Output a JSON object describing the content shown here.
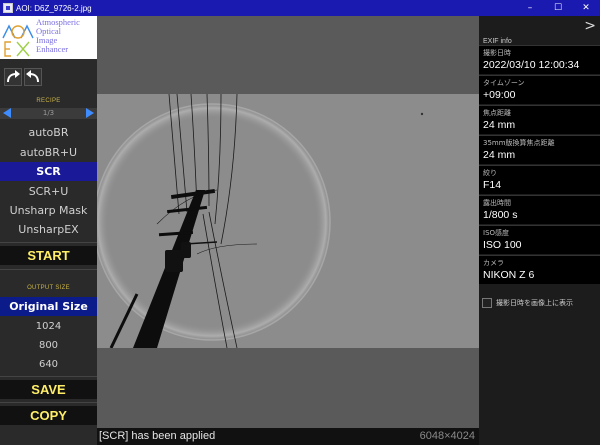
{
  "window": {
    "title": "AOI: D6Z_9726-2.jpg",
    "controls": {
      "minimize": "–",
      "maximize": "☐",
      "close": "✕"
    }
  },
  "logo": {
    "line1": "Atmospheric",
    "line2": "Optical",
    "line3": "Image",
    "line4": "Enhancer"
  },
  "recipe": {
    "label": "RECIPE",
    "pager": "1/3",
    "items": [
      "autoBR",
      "autoBR+U",
      "SCR",
      "SCR+U",
      "Unsharp Mask",
      "UnsharpEX"
    ],
    "active_index": 2
  },
  "start_label": "START",
  "output_size": {
    "label": "OUTPUT SIZE",
    "items": [
      "Original Size",
      "1024",
      "800",
      "640"
    ],
    "active_index": 0
  },
  "save_label": "SAVE",
  "copy_label": "COPY",
  "status": {
    "message": "[SCR] has been applied",
    "dimensions": "6048×4024"
  },
  "exif": {
    "title": "EXIF info",
    "collapse_glyph": ">",
    "rows": [
      {
        "label": "撮影日時",
        "value": "2022/03/10 12:00:34"
      },
      {
        "label": "タイムゾーン",
        "value": "+09:00"
      },
      {
        "label": "焦点距離",
        "value": "24 mm"
      },
      {
        "label": "35mm版換算焦点距離",
        "value": "24 mm"
      },
      {
        "label": "絞り",
        "value": "F14"
      },
      {
        "label": "露出時間",
        "value": "1/800 s"
      },
      {
        "label": "ISO感度",
        "value": "ISO 100"
      },
      {
        "label": "カメラ",
        "value": "NIKON Z 6"
      }
    ],
    "overlay_option": "撮影日時を画像上に表示"
  },
  "colors": {
    "titlebar": "#1a1ab0",
    "recipe_active": "#1a1a99",
    "action_text": "#ffee66",
    "section_label": "#c9b347",
    "nav_arrow": "#3f8cff"
  }
}
